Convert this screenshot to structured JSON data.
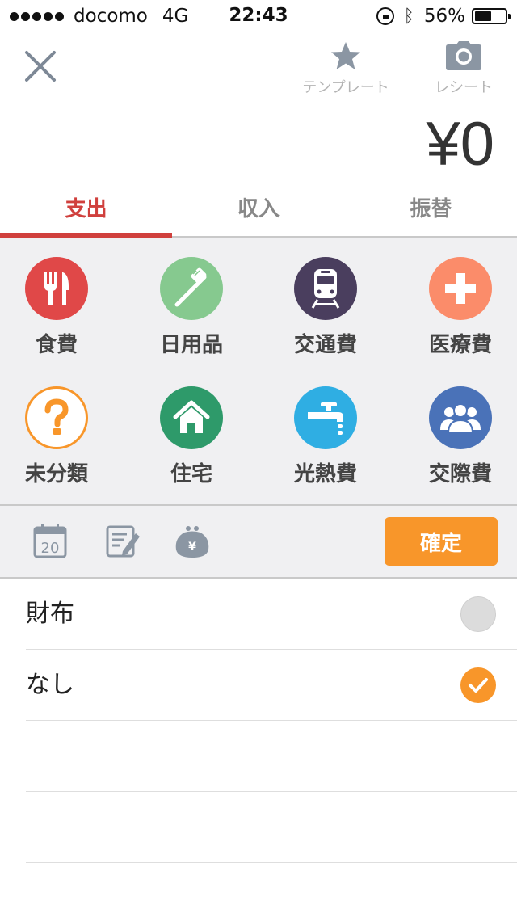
{
  "status_bar": {
    "carrier": "docomo",
    "network": "4G",
    "time": "22:43",
    "battery": "56%",
    "battery_level": 0.56
  },
  "header": {
    "template_label": "テンプレート",
    "receipt_label": "レシート",
    "amount": "¥0"
  },
  "tabs": [
    {
      "label": "支出",
      "active": true
    },
    {
      "label": "収入",
      "active": false
    },
    {
      "label": "振替",
      "active": false
    }
  ],
  "categories": [
    {
      "label": "食費",
      "icon": "fork-knife-icon",
      "color": "#e04848"
    },
    {
      "label": "日用品",
      "icon": "toothbrush-icon",
      "color": "#86c98f"
    },
    {
      "label": "交通費",
      "icon": "train-icon",
      "color": "#4a3e5e"
    },
    {
      "label": "医療費",
      "icon": "medical-cross-icon",
      "color": "#fb8c6a"
    },
    {
      "label": "未分類",
      "icon": "question-icon",
      "color": "#f8962a"
    },
    {
      "label": "住宅",
      "icon": "house-icon",
      "color": "#2e9a6a"
    },
    {
      "label": "光熱費",
      "icon": "faucet-icon",
      "color": "#2faee3"
    },
    {
      "label": "交際費",
      "icon": "people-icon",
      "color": "#4a72b8"
    }
  ],
  "toolbar": {
    "calendar_day": "20",
    "confirm_label": "確定"
  },
  "list": [
    {
      "label": "財布",
      "selected": false
    },
    {
      "label": "なし",
      "selected": true
    }
  ],
  "colors": {
    "accent_red": "#d0403d",
    "accent_orange": "#f8962a"
  }
}
